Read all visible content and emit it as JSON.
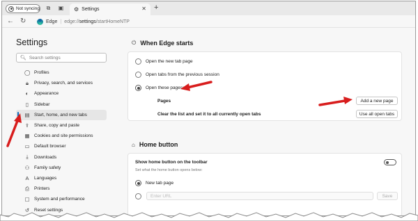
{
  "tabstrip": {
    "profile_label": "Not syncing",
    "tab_title": "Settings"
  },
  "address": {
    "site_label": "Edge",
    "url_scheme": "edge://",
    "url_path": "settings",
    "url_rest": "/startHomeNTP"
  },
  "sidebar": {
    "title": "Settings",
    "search_placeholder": "Search settings",
    "items": [
      {
        "label": "Profiles",
        "icon": "profile-icon"
      },
      {
        "label": "Privacy, search, and services",
        "icon": "lock-icon"
      },
      {
        "label": "Appearance",
        "icon": "appearance-icon"
      },
      {
        "label": "Sidebar",
        "icon": "sidebar-icon"
      },
      {
        "label": "Start, home, and new tabs",
        "icon": "home-tabs-icon",
        "active": true
      },
      {
        "label": "Share, copy and paste",
        "icon": "share-icon"
      },
      {
        "label": "Cookies and site permissions",
        "icon": "cookies-icon"
      },
      {
        "label": "Default browser",
        "icon": "browser-icon"
      },
      {
        "label": "Downloads",
        "icon": "download-icon"
      },
      {
        "label": "Family safety",
        "icon": "family-icon"
      },
      {
        "label": "Languages",
        "icon": "languages-icon"
      },
      {
        "label": "Printers",
        "icon": "printer-icon"
      },
      {
        "label": "System and performance",
        "icon": "system-icon"
      },
      {
        "label": "Reset settings",
        "icon": "reset-icon"
      }
    ]
  },
  "when_edge_starts": {
    "heading": "When Edge starts",
    "options": [
      {
        "label": "Open the new tab page",
        "selected": false
      },
      {
        "label": "Open tabs from the previous session",
        "selected": false
      },
      {
        "label": "Open these pages:",
        "selected": true
      }
    ],
    "pages_label": "Pages",
    "add_page_button": "Add a new page",
    "clear_label": "Clear the list and set it to all currently open tabs",
    "use_all_tabs_button": "Use all open tabs"
  },
  "home_button": {
    "heading": "Home button",
    "toggle_label": "Show home button on the toolbar",
    "toggle_on": false,
    "description": "Set what the home button opens below:",
    "options": [
      {
        "label": "New tab page",
        "selected": true
      }
    ],
    "url_placeholder": "Enter URL",
    "save_button": "Save"
  },
  "colors": {
    "annotation_arrow": "#d81d1d",
    "active_accent": "#0f6cbd"
  }
}
